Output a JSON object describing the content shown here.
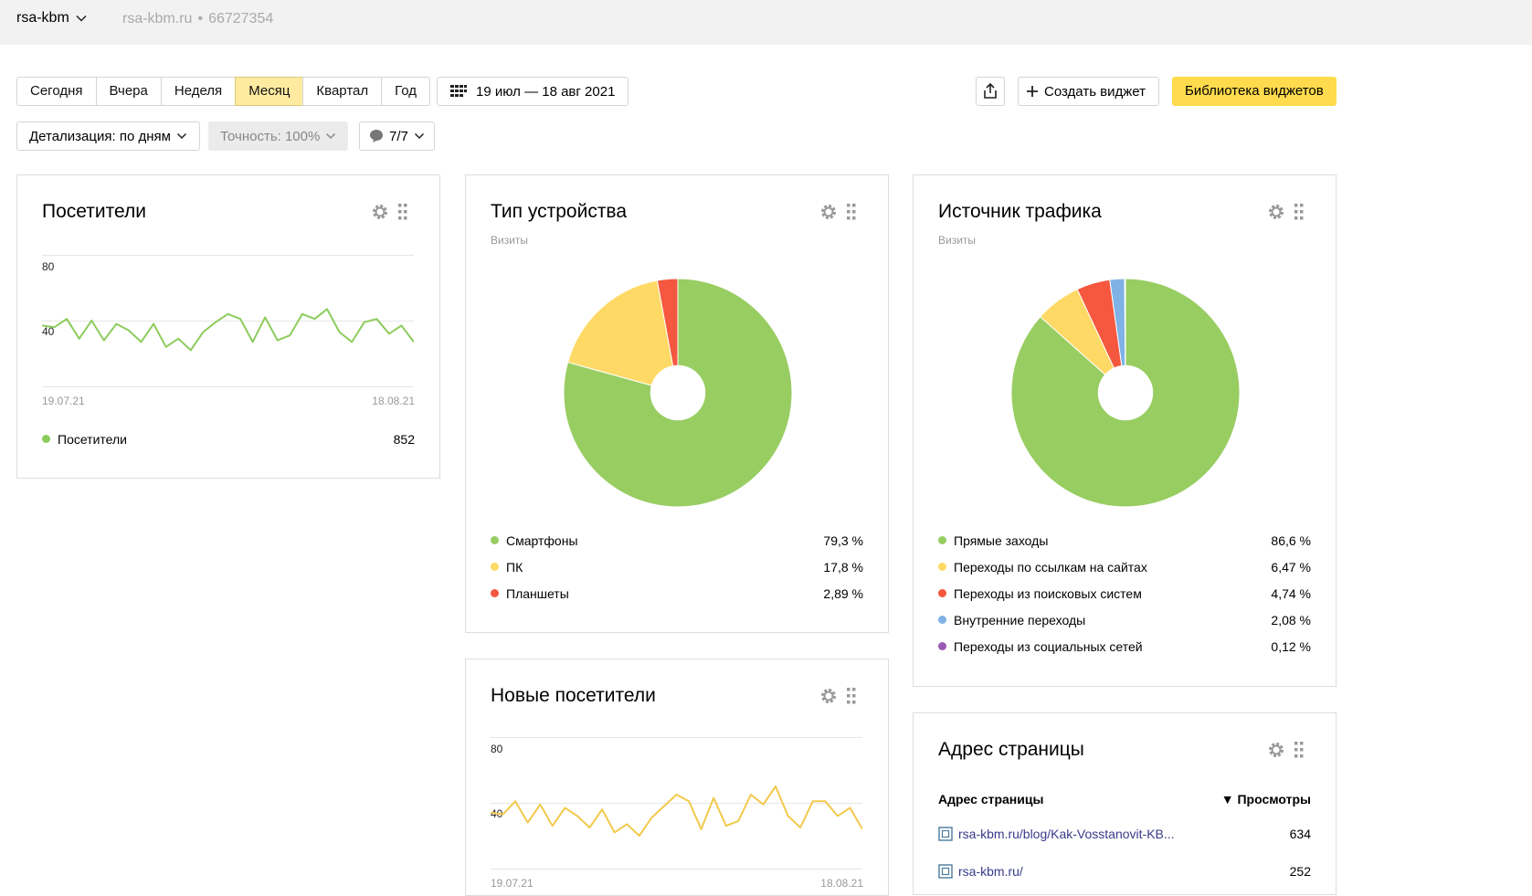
{
  "header": {
    "counter_name": "rsa-kbm",
    "site": "rsa-kbm.ru",
    "counter_id": "66727354"
  },
  "toolbar": {
    "periods": [
      {
        "label": "Сегодня",
        "active": false
      },
      {
        "label": "Вчера",
        "active": false
      },
      {
        "label": "Неделя",
        "active": false
      },
      {
        "label": "Месяц",
        "active": true
      },
      {
        "label": "Квартал",
        "active": false
      },
      {
        "label": "Год",
        "active": false
      }
    ],
    "date_range": "19 июл — 18 авг 2021",
    "create_widget": "Создать виджет",
    "widget_library": "Библиотека виджетов",
    "detail": "Детализация: по дням",
    "accuracy": "Точность: 100%",
    "segments": "7/7"
  },
  "widgets": {
    "visitors": {
      "title": "Посетители",
      "y_tick_top": "80",
      "y_tick_mid": "40",
      "date_start": "19.07.21",
      "date_end": "18.08.21",
      "legend_label": "Посетители",
      "legend_value": "852",
      "color": "#8ccc5c"
    },
    "device": {
      "title": "Тип устройства",
      "subtitle": "Визиты",
      "items": [
        {
          "label": "Смартфоны",
          "value": "79,3 %",
          "color": "#98cd62"
        },
        {
          "label": "ПК",
          "value": "17,8 %",
          "color": "#ffd966"
        },
        {
          "label": "Планшеты",
          "value": "2,89 %",
          "color": "#f5583e"
        }
      ]
    },
    "traffic": {
      "title": "Источник трафика",
      "subtitle": "Визиты",
      "items": [
        {
          "label": "Прямые заходы",
          "value": "86,6 %",
          "color": "#98cd62"
        },
        {
          "label": "Переходы по ссылкам на сайтах",
          "value": "6,47 %",
          "color": "#ffd966"
        },
        {
          "label": "Переходы из поисковых систем",
          "value": "4,74 %",
          "color": "#f5583e"
        },
        {
          "label": "Внутренние переходы",
          "value": "2,08 %",
          "color": "#7fb2e5"
        },
        {
          "label": "Переходы из социальных сетей",
          "value": "0,12 %",
          "color": "#9b59b6"
        }
      ]
    },
    "new_visitors": {
      "title": "Новые посетители",
      "y_tick_top": "80",
      "y_tick_mid": "40",
      "date_start": "19.07.21",
      "date_end": "18.08.21",
      "color": "#f2c94c"
    },
    "page_address": {
      "title": "Адрес страницы",
      "col_address": "Адрес страницы",
      "col_views": "▼ Просмотры",
      "rows": [
        {
          "url": "rsa-kbm.ru/blog/Kak-Vosstanovit-KB...",
          "views": "634"
        },
        {
          "url": "rsa-kbm.ru/",
          "views": "252"
        }
      ]
    }
  },
  "chart_data": [
    {
      "type": "line",
      "title": "Посетители",
      "x": [
        "19.07.21",
        "20.07.21",
        "21.07.21",
        "22.07.21",
        "23.07.21",
        "24.07.21",
        "25.07.21",
        "26.07.21",
        "27.07.21",
        "28.07.21",
        "29.07.21",
        "30.07.21",
        "31.07.21",
        "01.08.21",
        "02.08.21",
        "03.08.21",
        "04.08.21",
        "05.08.21",
        "06.08.21",
        "07.08.21",
        "08.08.21",
        "09.08.21",
        "10.08.21",
        "11.08.21",
        "12.08.21",
        "13.08.21",
        "14.08.21",
        "15.08.21",
        "16.08.21",
        "17.08.21",
        "18.08.21"
      ],
      "series": [
        {
          "name": "Посетители",
          "values": [
            37,
            36,
            41,
            29,
            40,
            28,
            38,
            34,
            27,
            38,
            24,
            29,
            22,
            33,
            39,
            44,
            41,
            27,
            42,
            28,
            31,
            44,
            41,
            47,
            33,
            27,
            39,
            41,
            32,
            37,
            27
          ]
        }
      ],
      "ylim": [
        0,
        80
      ]
    },
    {
      "type": "pie",
      "title": "Тип устройства",
      "categories": [
        "Смартфоны",
        "ПК",
        "Планшеты"
      ],
      "values": [
        79.3,
        17.8,
        2.89
      ]
    },
    {
      "type": "pie",
      "title": "Источник трафика",
      "categories": [
        "Прямые заходы",
        "Переходы по ссылкам на сайтах",
        "Переходы из поисковых систем",
        "Внутренние переходы",
        "Переходы из социальных сетей"
      ],
      "values": [
        86.6,
        6.47,
        4.74,
        2.08,
        0.12
      ]
    },
    {
      "type": "line",
      "title": "Новые посетители",
      "x": [
        "19.07.21",
        "20.07.21",
        "21.07.21",
        "22.07.21",
        "23.07.21",
        "24.07.21",
        "25.07.21",
        "26.07.21",
        "27.07.21",
        "28.07.21",
        "29.07.21",
        "30.07.21",
        "31.07.21",
        "01.08.21",
        "02.08.21",
        "03.08.21",
        "04.08.21",
        "05.08.21",
        "06.08.21",
        "07.08.21",
        "08.08.21",
        "09.08.21",
        "10.08.21",
        "11.08.21",
        "12.08.21",
        "13.08.21",
        "14.08.21",
        "15.08.21",
        "16.08.21",
        "17.08.21",
        "18.08.21"
      ],
      "series": [
        {
          "name": "Новые посетители",
          "values": [
            34,
            33,
            41,
            28,
            39,
            26,
            37,
            32,
            25,
            36,
            22,
            27,
            20,
            31,
            38,
            45,
            41,
            24,
            43,
            26,
            29,
            45,
            39,
            50,
            32,
            25,
            41,
            41,
            32,
            37,
            24
          ]
        }
      ],
      "ylim": [
        0,
        80
      ]
    }
  ]
}
